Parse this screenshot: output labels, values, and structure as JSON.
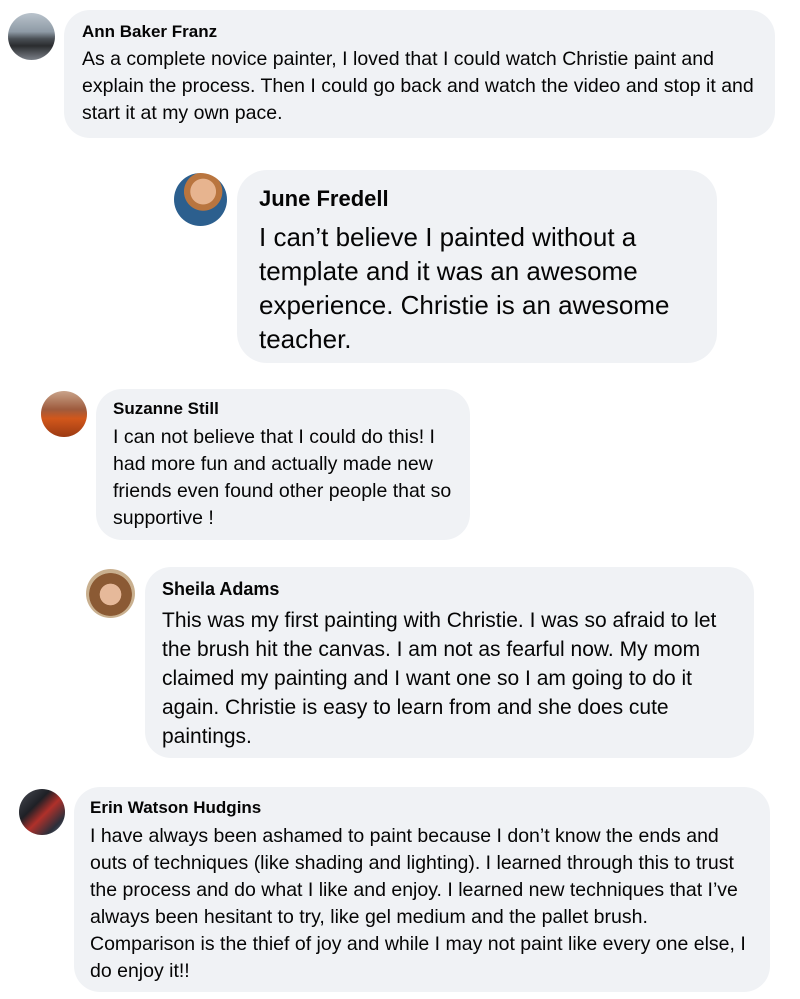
{
  "comments": [
    {
      "author": "Ann Baker Franz",
      "text": "As a complete novice painter, I loved that I could watch Christie paint and explain the process. Then I could go back and watch the video and stop it and start it at my own pace."
    },
    {
      "author": "June Fredell",
      "text": "I can’t believe I painted without a template and it was an awesome experience. Christie is an awesome teacher."
    },
    {
      "author": "Suzanne Still",
      "text": "I can not believe that I could do this! I had more fun and actually made new friends even found other people that so supportive !"
    },
    {
      "author": "Sheila Adams",
      "text": "This was my first painting with Christie. I was so afraid to let the brush hit the canvas. I am not as fearful now. My mom claimed my painting and I want one so I am going to do it again. Christie is easy to learn from and she does cute paintings."
    },
    {
      "author": "Erin Watson Hudgins",
      "text": "I have always been ashamed to paint because I don’t know the ends and outs of techniques (like shading and lighting). I learned through this to trust the process and do what I like and enjoy. I learned new techniques that I’ve always been hesitant to try, like gel medium and the pallet brush. Comparison is the thief of joy and while I may not paint like every one else, I do enjoy it!!"
    }
  ],
  "colors": {
    "bubble": "#f0f2f5",
    "text": "#050505",
    "background": "#ffffff"
  }
}
